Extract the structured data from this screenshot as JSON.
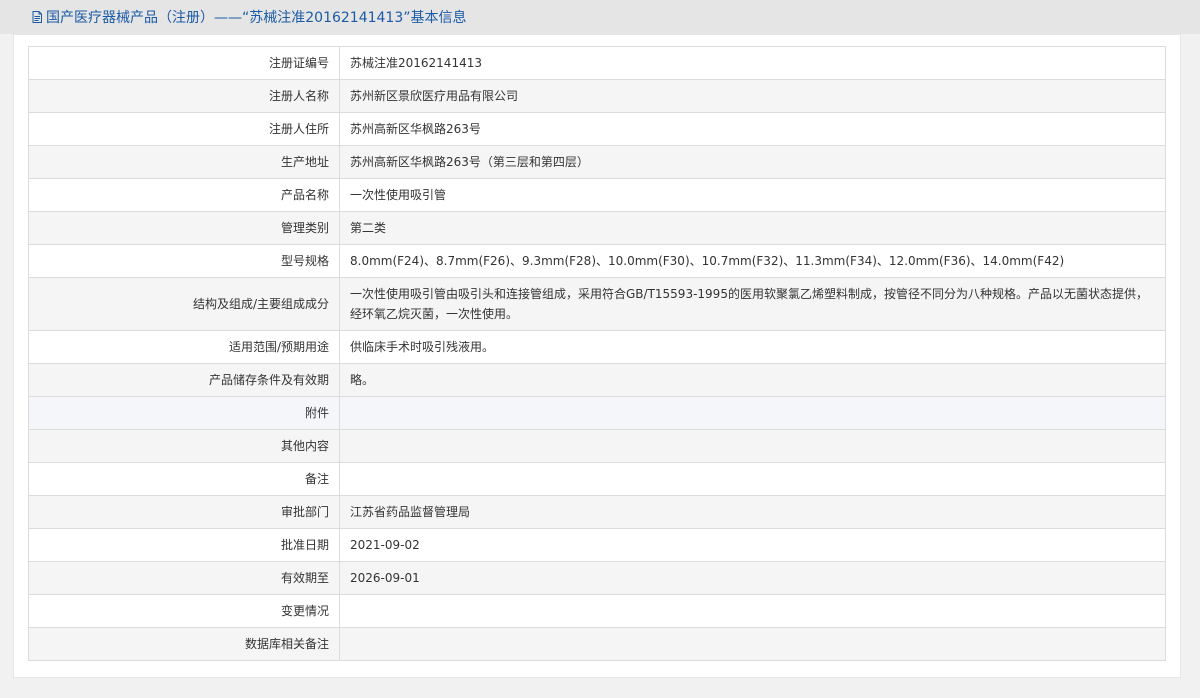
{
  "header": {
    "title": "国产医疗器械产品（注册）——“苏械注准20162141413”基本信息",
    "icon": "document-icon"
  },
  "rows": [
    {
      "label": "注册证编号",
      "value": "苏械注准20162141413"
    },
    {
      "label": "注册人名称",
      "value": "苏州新区景欣医疗用品有限公司"
    },
    {
      "label": "注册人住所",
      "value": "苏州高新区华枫路263号"
    },
    {
      "label": "生产地址",
      "value": "苏州高新区华枫路263号（第三层和第四层）"
    },
    {
      "label": "产品名称",
      "value": "一次性使用吸引管"
    },
    {
      "label": "管理类别",
      "value": "第二类"
    },
    {
      "label": "型号规格",
      "value": "8.0mm(F24)、8.7mm(F26)、9.3mm(F28)、10.0mm(F30)、10.7mm(F32)、11.3mm(F34)、12.0mm(F36)、14.0mm(F42)"
    },
    {
      "label": "结构及组成/主要组成成分",
      "value": "一次性使用吸引管由吸引头和连接管组成，采用符合GB/T15593-1995的医用软聚氯乙烯塑料制成，按管径不同分为八种规格。产品以无菌状态提供，经环氧乙烷灭菌，一次性使用。"
    },
    {
      "label": "适用范围/预期用途",
      "value": "供临床手术时吸引残液用。"
    },
    {
      "label": "产品储存条件及有效期",
      "value": "略。"
    },
    {
      "label": "附件",
      "value": ""
    },
    {
      "label": "其他内容",
      "value": ""
    },
    {
      "label": "备注",
      "value": ""
    },
    {
      "label": "审批部门",
      "value": "江苏省药品监督管理局"
    },
    {
      "label": "批准日期",
      "value": "2021-09-02"
    },
    {
      "label": "有效期至",
      "value": "2026-09-01"
    },
    {
      "label": "变更情况",
      "value": ""
    },
    {
      "label": "数据库相关备注",
      "value": ""
    }
  ],
  "colors": {
    "title": "#1a5aa6",
    "header_bg": "#e5e5e5",
    "page_bg": "#f1f1f1",
    "row_alt": "#f5f5f5",
    "row_highlight": "#f4f6fa",
    "border": "#dcdcdc"
  }
}
